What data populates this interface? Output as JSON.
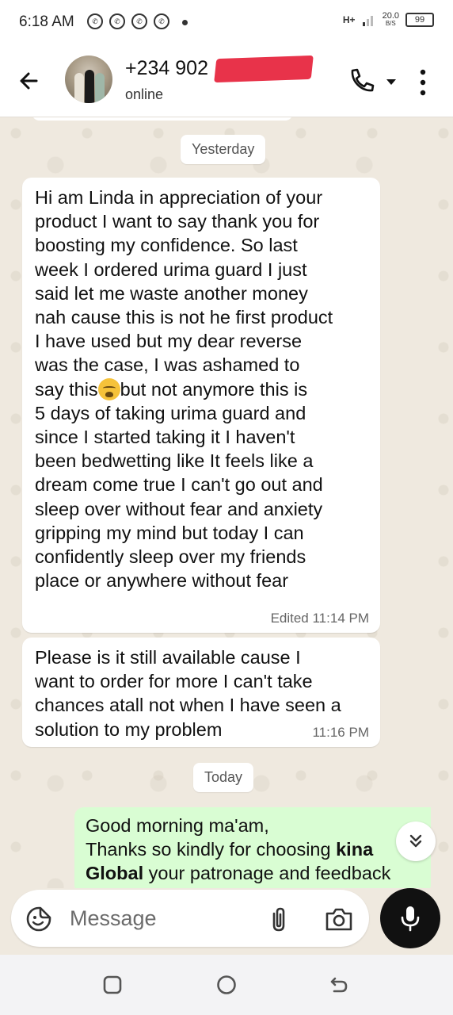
{
  "status_bar": {
    "time": "6:18 AM",
    "notification_icons": [
      "whatsapp-icon",
      "whatsapp-icon",
      "whatsapp-icon",
      "whatsapp-icon"
    ],
    "network": "H+",
    "speed_value": "20.0",
    "speed_unit": "B/S",
    "battery": "99"
  },
  "header": {
    "contact_name": "+234 902",
    "status": "online"
  },
  "chat": {
    "yesterday_label": "Yesterday",
    "today_label": "Today",
    "message1": {
      "text_before_emoji": "Hi am Linda in appreciation of your\nproduct I want to say thank you for\nboosting my confidence. So last\nweek I ordered urima guard I just\nsaid let me waste another money\nnah cause this is not he first product\nI have used but my dear reverse\nwas the case, I was ashamed to\nsay this",
      "emoji": "crying-face-emoji",
      "text_after_emoji": "but not anymore this is\n5 days of taking urima guard and\nsince I started taking it I haven't\nbeen bedwetting like It feels like a\ndream come true I can't go out and\nsleep over without fear and anxiety\ngripping my mind but today I can\nconfidently sleep over my friends\nplace or anywhere without fear",
      "meta": "Edited 11:14 PM"
    },
    "message2": {
      "text": "Please is it still available cause I\nwant to order for more I can't take\nchances atall not when I have seen a\nsolution to my problem",
      "time": "11:16 PM"
    },
    "outgoing": {
      "line1": "Good morning ma'am,",
      "line2_prefix": "Thanks so kindly for choosing ",
      "brand1": "kina",
      "brand2": "Global",
      "line3_rest": " your patronage and feedback"
    }
  },
  "composer": {
    "placeholder": "Message"
  },
  "colors": {
    "chat_bg": "#efe9df",
    "incoming_bubble": "#ffffff",
    "outgoing_bubble": "#d9fdd3",
    "mic_button": "#111111",
    "redaction": "#e8334a"
  }
}
